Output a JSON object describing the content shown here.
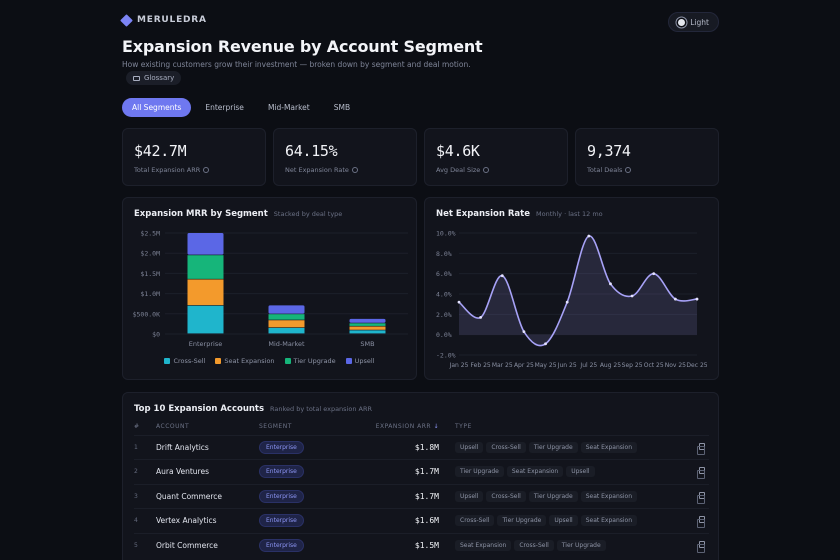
{
  "brand": {
    "name": "MERULEDRA"
  },
  "theme_toggle": {
    "label": "Light"
  },
  "page": {
    "title": "Expansion Revenue by Account Segment",
    "subtitle": "How existing customers grow their investment — broken down by segment and deal motion.",
    "glossary_label": "Glossary"
  },
  "tabs": [
    {
      "label": "All Segments",
      "active": true
    },
    {
      "label": "Enterprise",
      "active": false
    },
    {
      "label": "Mid-Market",
      "active": false
    },
    {
      "label": "SMB",
      "active": false
    }
  ],
  "kpis": [
    {
      "value": "$42.7M",
      "label": "Total Expansion ARR"
    },
    {
      "value": "64.15%",
      "label": "Net Expansion Rate"
    },
    {
      "value": "$4.6K",
      "label": "Avg Deal Size"
    },
    {
      "value": "9,374",
      "label": "Total Deals"
    }
  ],
  "colors": {
    "cross_sell": "#1fb5cc",
    "seat_expansion": "#f39a2c",
    "tier_upgrade": "#16b57a",
    "upsell": "#5b67e6",
    "line": "#a7a2f7",
    "accent": "#6f78f0"
  },
  "bar_chart": {
    "title": "Expansion MRR by Segment",
    "subtitle": "Stacked by deal type"
  },
  "line_chart": {
    "title": "Net Expansion Rate",
    "subtitle": "Monthly · last 12 mo"
  },
  "chart_data": [
    {
      "type": "bar",
      "stacked": true,
      "title": "Expansion MRR by Segment",
      "categories": [
        "Enterprise",
        "Mid-Market",
        "SMB"
      ],
      "series": [
        {
          "name": "Cross-Sell",
          "values": [
            700000,
            150000,
            90000
          ]
        },
        {
          "name": "Seat Expansion",
          "values": [
            650000,
            190000,
            95000
          ]
        },
        {
          "name": "Tier Upgrade",
          "values": [
            600000,
            150000,
            80000
          ]
        },
        {
          "name": "Upsell",
          "values": [
            550000,
            220000,
            110000
          ]
        }
      ],
      "yticks": [
        "$0",
        "$500.0K",
        "$1.0M",
        "$1.5M",
        "$2.0M",
        "$2.5M"
      ],
      "ylim": [
        0,
        2500000
      ],
      "legend": "bottom"
    },
    {
      "type": "area",
      "title": "Net Expansion Rate",
      "x": [
        "Jan 25",
        "Feb 25",
        "Mar 25",
        "Apr 25",
        "May 25",
        "Jun 25",
        "Jul 25",
        "Aug 25",
        "Sep 25",
        "Oct 25",
        "Nov 25",
        "Dec 25"
      ],
      "y": [
        3.2,
        1.7,
        5.8,
        0.3,
        -0.9,
        3.2,
        9.7,
        5.0,
        3.8,
        6.0,
        3.5,
        3.5
      ],
      "yticks": [
        "-2.0%",
        "0.0%",
        "2.0%",
        "4.0%",
        "6.0%",
        "8.0%",
        "10.0%"
      ],
      "ylim": [
        -2,
        10
      ]
    }
  ],
  "table": {
    "title": "Top 10 Expansion Accounts",
    "subtitle": "Ranked by total expansion ARR",
    "columns": [
      "#",
      "ACCOUNT",
      "SEGMENT",
      "EXPANSION ARR",
      "TYPE"
    ],
    "rows": [
      {
        "rank": "1",
        "account": "Drift Analytics",
        "segment": "Enterprise",
        "arr": "$1.8M",
        "types": [
          "Upsell",
          "Cross-Sell",
          "Tier Upgrade",
          "Seat Expansion"
        ]
      },
      {
        "rank": "2",
        "account": "Aura Ventures",
        "segment": "Enterprise",
        "arr": "$1.7M",
        "types": [
          "Tier Upgrade",
          "Seat Expansion",
          "Upsell"
        ]
      },
      {
        "rank": "3",
        "account": "Quant Commerce",
        "segment": "Enterprise",
        "arr": "$1.7M",
        "types": [
          "Upsell",
          "Cross-Sell",
          "Tier Upgrade",
          "Seat Expansion"
        ]
      },
      {
        "rank": "4",
        "account": "Vertex Analytics",
        "segment": "Enterprise",
        "arr": "$1.6M",
        "types": [
          "Cross-Sell",
          "Tier Upgrade",
          "Upsell",
          "Seat Expansion"
        ]
      },
      {
        "rank": "5",
        "account": "Orbit Commerce",
        "segment": "Enterprise",
        "arr": "$1.5M",
        "types": [
          "Seat Expansion",
          "Cross-Sell",
          "Tier Upgrade"
        ]
      }
    ]
  }
}
